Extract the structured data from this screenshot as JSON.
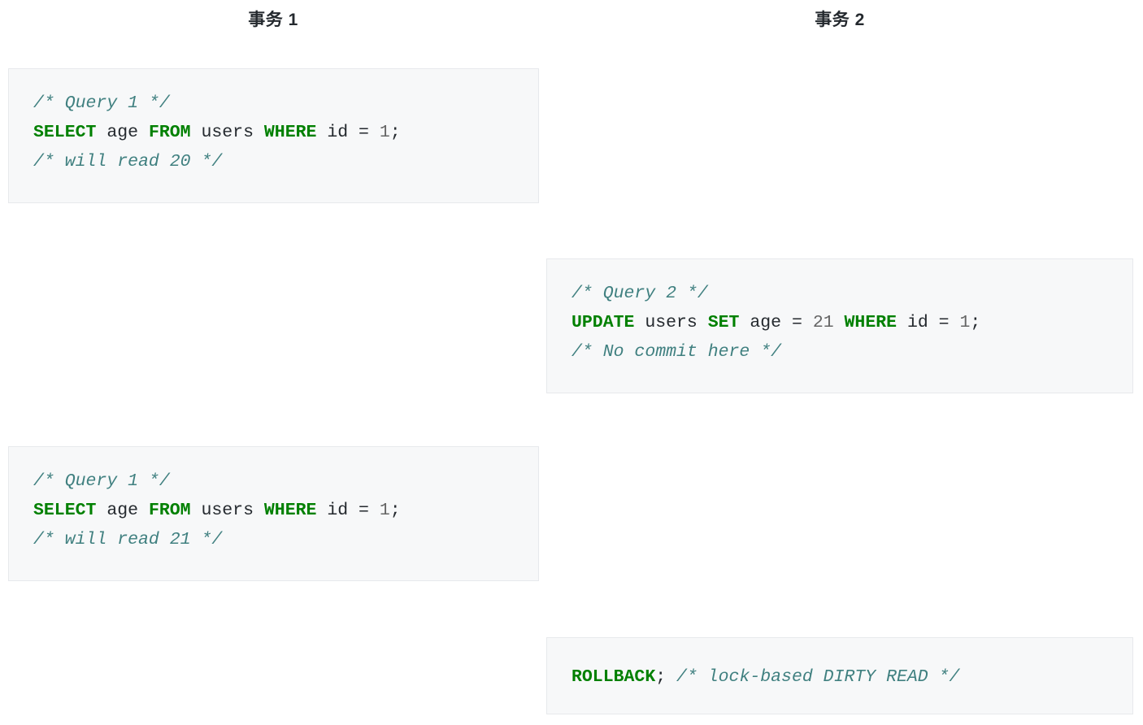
{
  "columns": [
    {
      "id": "transaction-1",
      "title": "事务 1"
    },
    {
      "id": "transaction-2",
      "title": "事务 2"
    }
  ],
  "blocks": [
    {
      "id": "q1-first",
      "column": "transaction-1",
      "lines": [
        {
          "tokens": [
            {
              "t": "comment",
              "v": "/* Query 1 */"
            }
          ]
        },
        {
          "tokens": [
            {
              "t": "keyword",
              "v": "SELECT"
            },
            {
              "t": "plain",
              "v": " "
            },
            {
              "t": "name",
              "v": "age"
            },
            {
              "t": "plain",
              "v": " "
            },
            {
              "t": "keyword",
              "v": "FROM"
            },
            {
              "t": "plain",
              "v": " "
            },
            {
              "t": "name",
              "v": "users"
            },
            {
              "t": "plain",
              "v": " "
            },
            {
              "t": "keyword",
              "v": "WHERE"
            },
            {
              "t": "plain",
              "v": " "
            },
            {
              "t": "name",
              "v": "id"
            },
            {
              "t": "plain",
              "v": " "
            },
            {
              "t": "operator",
              "v": "="
            },
            {
              "t": "plain",
              "v": " "
            },
            {
              "t": "number",
              "v": "1"
            },
            {
              "t": "punct",
              "v": ";"
            }
          ]
        },
        {
          "tokens": [
            {
              "t": "comment",
              "v": "/* will read 20 */"
            }
          ]
        }
      ]
    },
    {
      "id": "q2-update",
      "column": "transaction-2",
      "lines": [
        {
          "tokens": [
            {
              "t": "comment",
              "v": "/* Query 2 */"
            }
          ]
        },
        {
          "tokens": [
            {
              "t": "keyword",
              "v": "UPDATE"
            },
            {
              "t": "plain",
              "v": " "
            },
            {
              "t": "name",
              "v": "users"
            },
            {
              "t": "plain",
              "v": " "
            },
            {
              "t": "keyword",
              "v": "SET"
            },
            {
              "t": "plain",
              "v": " "
            },
            {
              "t": "name",
              "v": "age"
            },
            {
              "t": "plain",
              "v": " "
            },
            {
              "t": "operator",
              "v": "="
            },
            {
              "t": "plain",
              "v": " "
            },
            {
              "t": "number",
              "v": "21"
            },
            {
              "t": "plain",
              "v": " "
            },
            {
              "t": "keyword",
              "v": "WHERE"
            },
            {
              "t": "plain",
              "v": " "
            },
            {
              "t": "name",
              "v": "id"
            },
            {
              "t": "plain",
              "v": " "
            },
            {
              "t": "operator",
              "v": "="
            },
            {
              "t": "plain",
              "v": " "
            },
            {
              "t": "number",
              "v": "1"
            },
            {
              "t": "punct",
              "v": ";"
            }
          ]
        },
        {
          "tokens": [
            {
              "t": "comment",
              "v": "/* No commit here */"
            }
          ]
        }
      ]
    },
    {
      "id": "q1-second",
      "column": "transaction-1",
      "lines": [
        {
          "tokens": [
            {
              "t": "comment",
              "v": "/* Query 1 */"
            }
          ]
        },
        {
          "tokens": [
            {
              "t": "keyword",
              "v": "SELECT"
            },
            {
              "t": "plain",
              "v": " "
            },
            {
              "t": "name",
              "v": "age"
            },
            {
              "t": "plain",
              "v": " "
            },
            {
              "t": "keyword",
              "v": "FROM"
            },
            {
              "t": "plain",
              "v": " "
            },
            {
              "t": "name",
              "v": "users"
            },
            {
              "t": "plain",
              "v": " "
            },
            {
              "t": "keyword",
              "v": "WHERE"
            },
            {
              "t": "plain",
              "v": " "
            },
            {
              "t": "name",
              "v": "id"
            },
            {
              "t": "plain",
              "v": " "
            },
            {
              "t": "operator",
              "v": "="
            },
            {
              "t": "plain",
              "v": " "
            },
            {
              "t": "number",
              "v": "1"
            },
            {
              "t": "punct",
              "v": ";"
            }
          ]
        },
        {
          "tokens": [
            {
              "t": "comment",
              "v": "/* will read 21 */"
            }
          ]
        }
      ]
    },
    {
      "id": "rollback",
      "column": "transaction-2",
      "lines": [
        {
          "tokens": [
            {
              "t": "keyword",
              "v": "ROLLBACK"
            },
            {
              "t": "punct",
              "v": ";"
            },
            {
              "t": "plain",
              "v": " "
            },
            {
              "t": "comment",
              "v": "/* lock-based DIRTY READ */"
            }
          ]
        }
      ]
    }
  ],
  "theme": {
    "background": "#ffffff",
    "block_background": "#f7f8f9",
    "block_border": "#e7e9ec",
    "keyword_color": "#008000",
    "comment_color": "#408080",
    "number_color": "#666666",
    "text_color": "#24292e",
    "heading_color": "#24292e"
  }
}
